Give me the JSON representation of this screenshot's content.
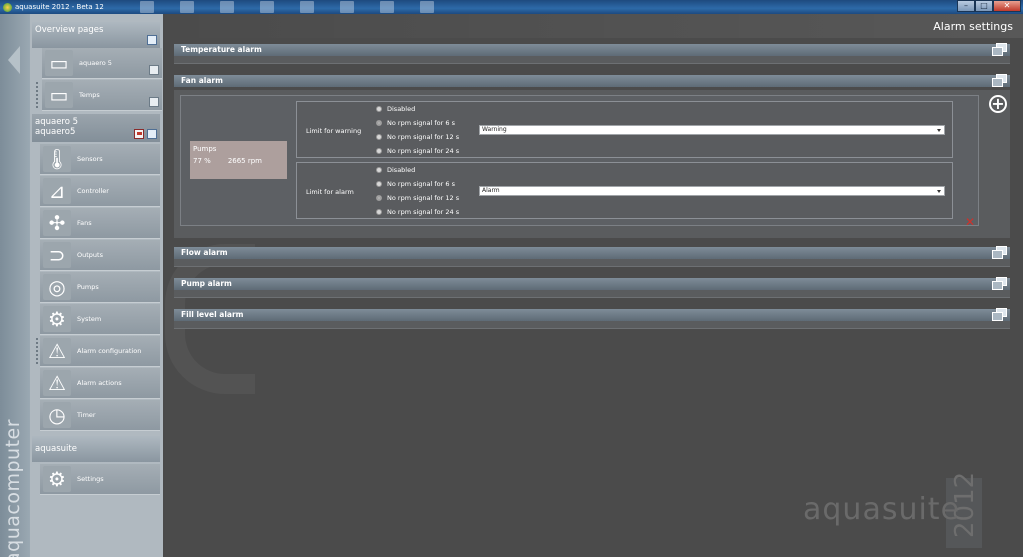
{
  "window": {
    "title": "aquasuite 2012 - Beta 12",
    "minimize": "–",
    "maximize": "□",
    "close": "✕"
  },
  "brand": "aquacomputer",
  "sidebar": {
    "overview_header": "Overview pages",
    "overview_items": [
      {
        "label": "aquaero 5",
        "icon": "pages-icon"
      },
      {
        "label": "Temps",
        "icon": "pages-icon"
      }
    ],
    "device_header_line1": "aquaero 5",
    "device_header_line2": "aquaero5",
    "device_items": [
      {
        "label": "Sensors",
        "icon": "thermometer-icon"
      },
      {
        "label": "Controller",
        "icon": "controller-icon"
      },
      {
        "label": "Fans",
        "icon": "fan-icon"
      },
      {
        "label": "Outputs",
        "icon": "output-icon"
      },
      {
        "label": "Pumps",
        "icon": "pump-icon"
      },
      {
        "label": "System",
        "icon": "system-icon"
      },
      {
        "label": "Alarm configuration",
        "icon": "alarm-icon"
      },
      {
        "label": "Alarm actions",
        "icon": "alarm-actions-icon"
      },
      {
        "label": "Timer",
        "icon": "clock-icon"
      }
    ],
    "suite_header": "aquasuite",
    "suite_items": [
      {
        "label": "Settings",
        "icon": "settings-icon"
      }
    ]
  },
  "main": {
    "title": "Alarm settings",
    "panels": {
      "temperature": "Temperature alarm",
      "fan": "Fan alarm",
      "flow": "Flow alarm",
      "pump": "Pump alarm",
      "fill": "Fill level alarm"
    },
    "fan_alarm": {
      "device_name": "Pumps",
      "device_percent": "77 %",
      "device_rpm": "2665 rpm",
      "warning": {
        "label": "Limit for warning",
        "options": [
          "Disabled",
          "No rpm signal for 6 s",
          "No rpm signal for 12 s",
          "No rpm signal for 24 s"
        ],
        "selected_index": 1,
        "action": "Warning"
      },
      "alarm": {
        "label": "Limit for alarm",
        "options": [
          "Disabled",
          "No rpm signal for 6 s",
          "No rpm signal for 12 s",
          "No rpm signal for 24 s"
        ],
        "selected_index": 2,
        "action": "Alarm"
      },
      "add_symbol": "+",
      "delete_symbol": "✕"
    },
    "watermark": "aquasuite",
    "watermark_year": "2012"
  }
}
